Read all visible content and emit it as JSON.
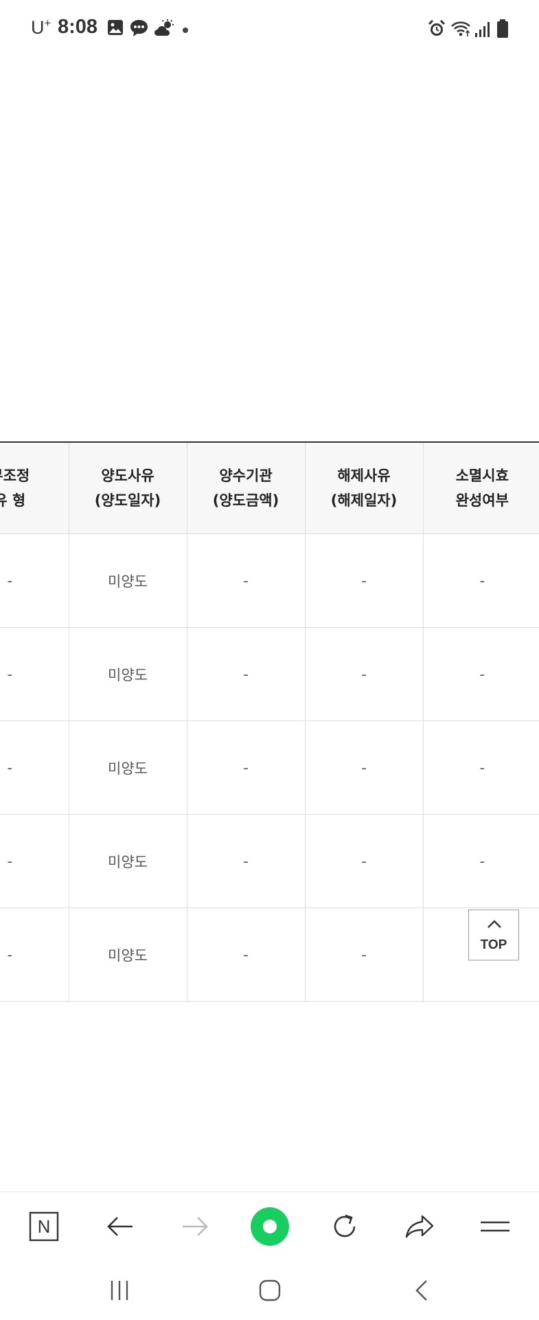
{
  "status_bar": {
    "carrier": "U",
    "carrier_sup": "+",
    "time": "8:08"
  },
  "table": {
    "headers": [
      [
        "무조정",
        "유 형"
      ],
      [
        "양도사유",
        "(양도일자)"
      ],
      [
        "양수기관",
        "(양도금액)"
      ],
      [
        "해제사유",
        "(해제일자)"
      ],
      [
        "소멸시효",
        "완성여부"
      ]
    ],
    "rows": [
      [
        "-",
        "미양도",
        "-",
        "-",
        "-"
      ],
      [
        "-",
        "미양도",
        "-",
        "-",
        "-"
      ],
      [
        "-",
        "미양도",
        "-",
        "-",
        "-"
      ],
      [
        "-",
        "미양도",
        "-",
        "-",
        "-"
      ],
      [
        "-",
        "미양도",
        "-",
        "-",
        ""
      ]
    ]
  },
  "top_button": {
    "label": "TOP"
  },
  "browser_toolbar": {
    "naver_letter": "N",
    "accent_color": "#19ce60"
  }
}
